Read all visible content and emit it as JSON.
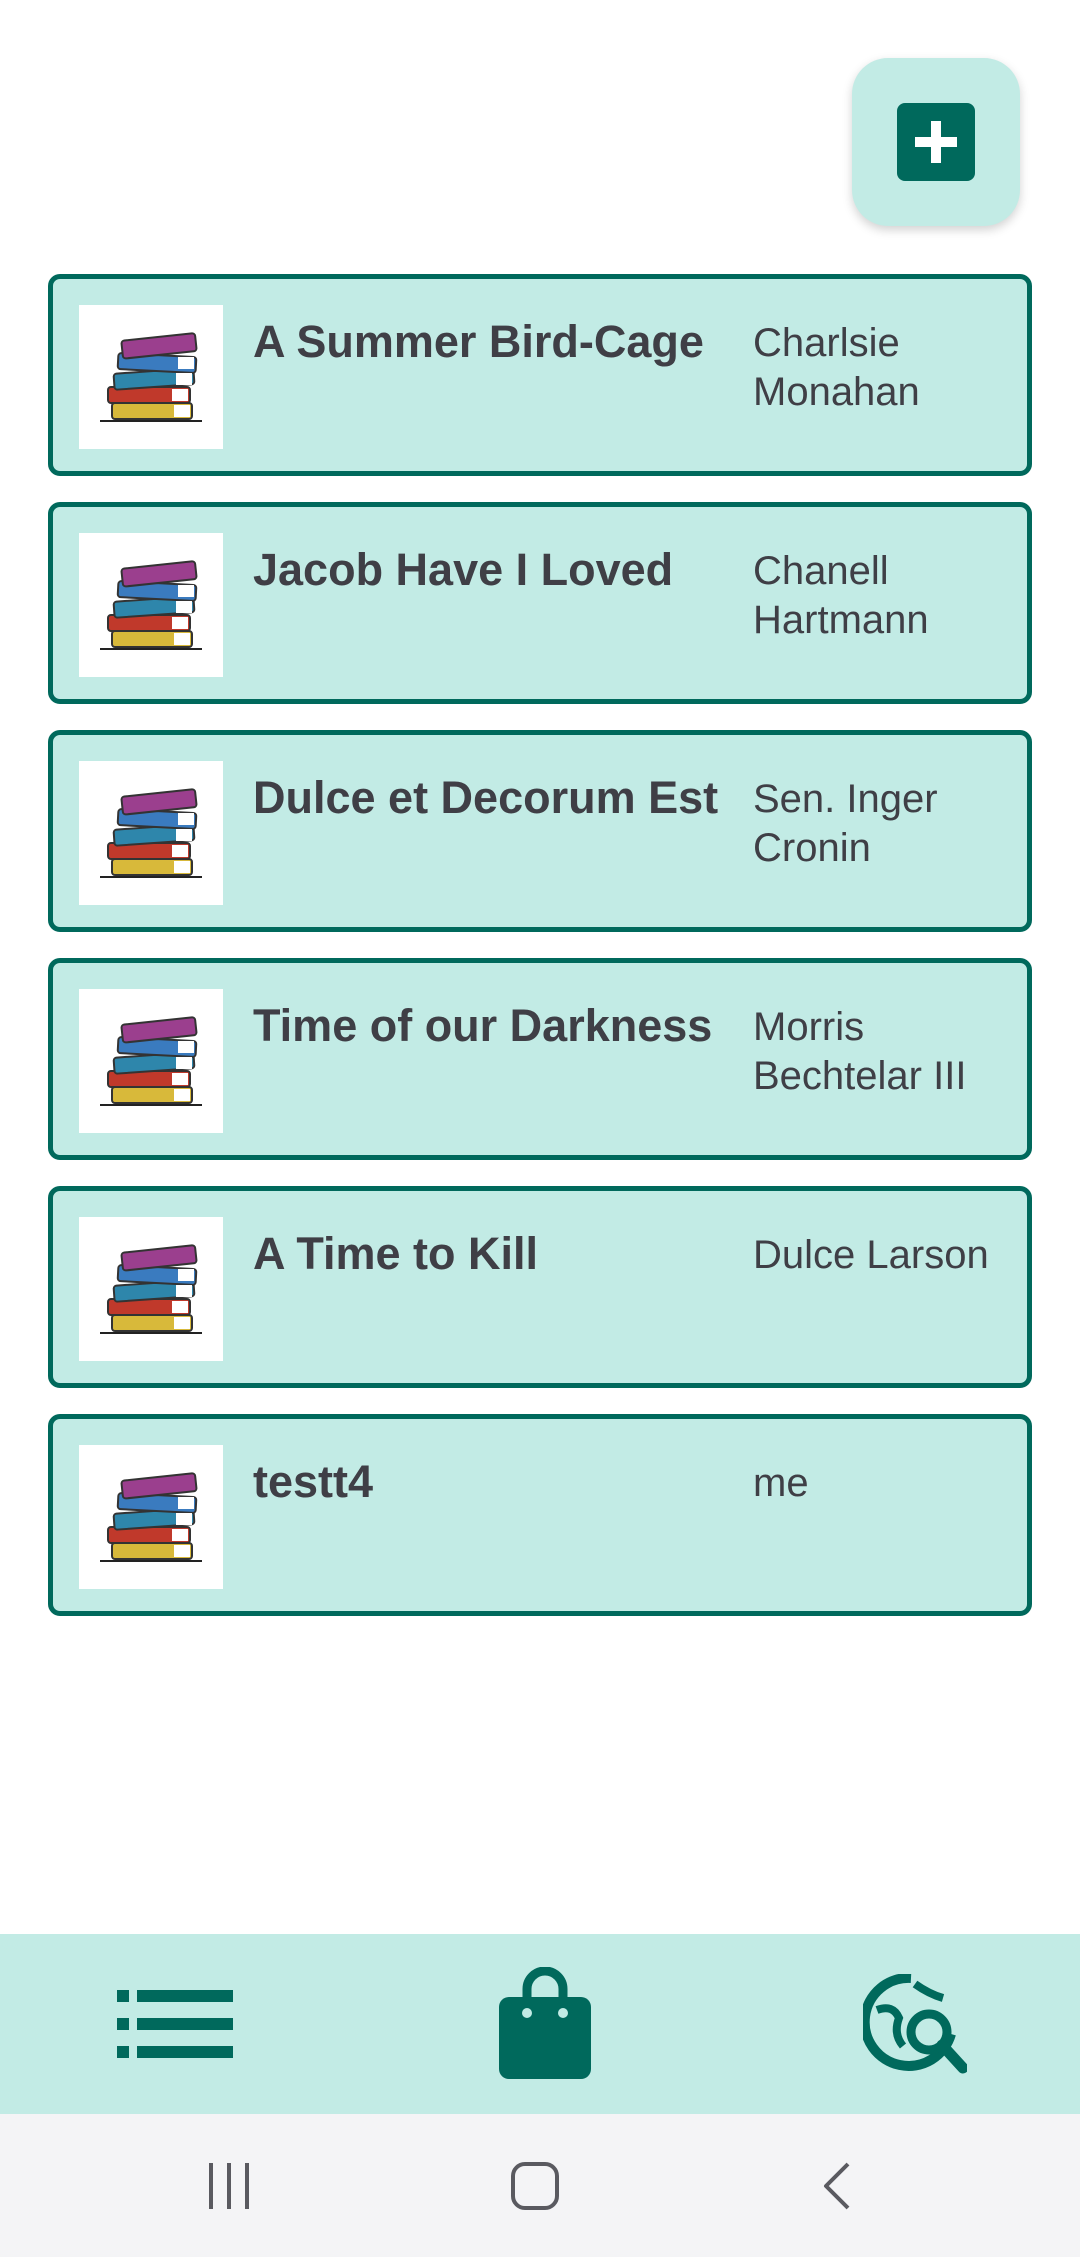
{
  "header": {
    "add_icon": "plus-icon"
  },
  "books": [
    {
      "title": "A Summer Bird-Cage",
      "author": "Charlsie Monahan"
    },
    {
      "title": "Jacob Have I Loved",
      "author": "Chanell Hartmann"
    },
    {
      "title": "Dulce et Decorum Est",
      "author": "Sen. Inger Cronin"
    },
    {
      "title": "Time of our Darkness",
      "author": "Morris Bechtelar III"
    },
    {
      "title": "A Time to Kill",
      "author": "Dulce Larson"
    },
    {
      "title": "testt4",
      "author": "me"
    }
  ],
  "bottom_nav": {
    "icons": [
      "list-icon",
      "shopping-bag-icon",
      "globe-search-icon"
    ]
  },
  "system_nav": {
    "icons": [
      "recents-icon",
      "home-icon",
      "back-icon"
    ]
  },
  "colors": {
    "accent": "#00695c",
    "card_bg": "#c2ebe5",
    "text": "#3f3f46"
  }
}
